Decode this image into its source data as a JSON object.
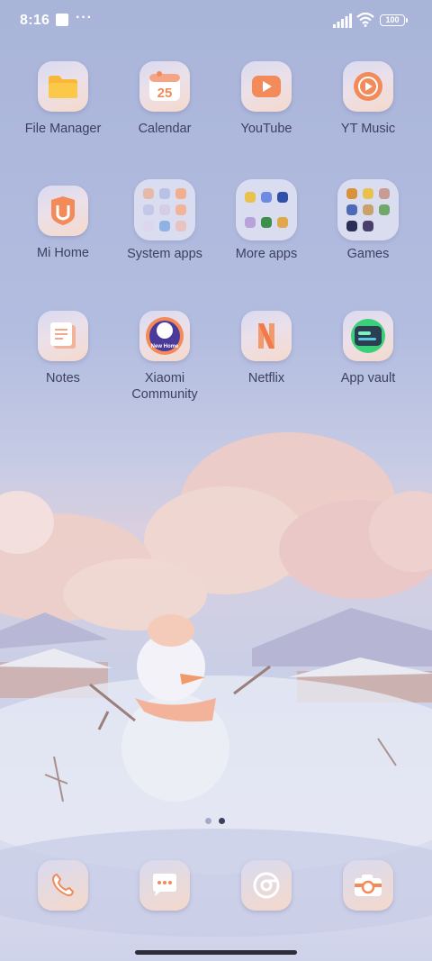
{
  "status_bar": {
    "time": "8:16",
    "more_indicator": "···",
    "battery": "100"
  },
  "apps": [
    {
      "label": "File Manager",
      "icon": "folder-icon"
    },
    {
      "label": "Calendar",
      "icon": "calendar-icon",
      "date": "25"
    },
    {
      "label": "YouTube",
      "icon": "youtube-icon"
    },
    {
      "label": "YT Music",
      "icon": "yt-music-icon"
    },
    {
      "label": "Mi Home",
      "icon": "mi-home-icon"
    },
    {
      "label": "System apps",
      "icon": "folder-group-icon"
    },
    {
      "label": "More apps",
      "icon": "folder-group-icon"
    },
    {
      "label": "Games",
      "icon": "folder-group-icon"
    },
    {
      "label": "Notes",
      "icon": "notes-icon"
    },
    {
      "label": "Xiaomi\nCommunity",
      "icon": "community-icon",
      "badge": "New Home"
    },
    {
      "label": "Netflix",
      "icon": "netflix-icon"
    },
    {
      "label": "App vault",
      "icon": "app-vault-icon"
    }
  ],
  "dock": [
    {
      "name": "phone",
      "icon": "phone-icon"
    },
    {
      "name": "messages",
      "icon": "messages-icon"
    },
    {
      "name": "browser",
      "icon": "chrome-icon"
    },
    {
      "name": "camera",
      "icon": "camera-icon"
    }
  ],
  "page_indicator": {
    "pages": 2,
    "current": 2
  },
  "colors": {
    "label": "#3d4060",
    "accent_orange": "#f28a5a",
    "icon_tile": "#e6dcec"
  }
}
